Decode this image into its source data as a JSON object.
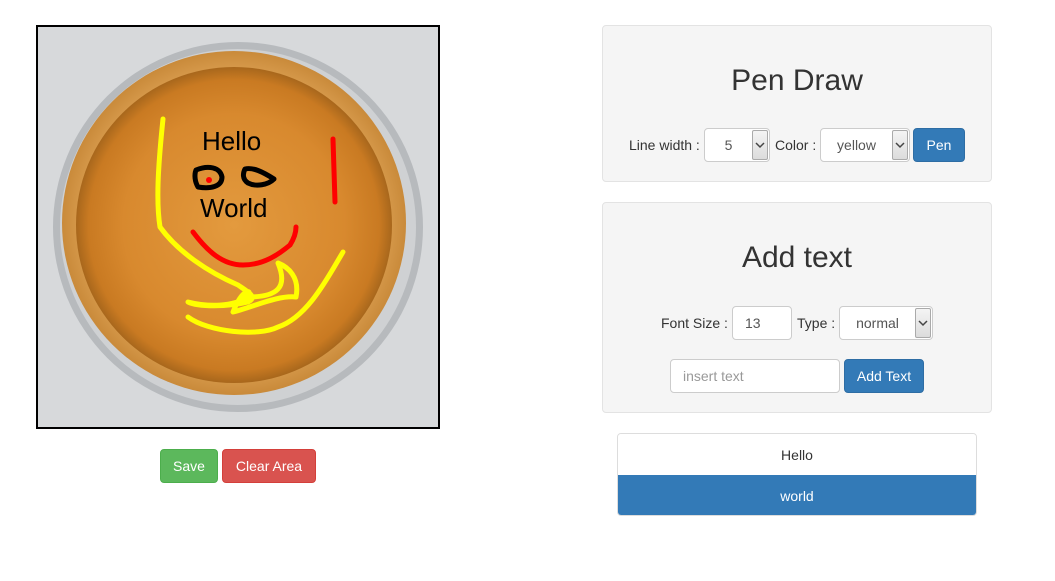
{
  "canvas": {
    "drawn_text": [
      "Hello",
      "World"
    ]
  },
  "actions": {
    "save_label": "Save",
    "clear_label": "Clear Area"
  },
  "pen_panel": {
    "title": "Pen Draw",
    "line_width_label": "Line width :",
    "line_width_value": "5",
    "color_label": "Color :",
    "color_value": "yellow",
    "pen_button": "Pen"
  },
  "text_panel": {
    "title": "Add text",
    "font_size_label": "Font Size :",
    "font_size_value": "13",
    "type_label": "Type :",
    "type_value": "normal",
    "text_placeholder": "insert text",
    "add_button": "Add Text"
  },
  "text_list": {
    "items": [
      "Hello",
      "world"
    ],
    "active_index": 1
  },
  "colors": {
    "success": "#5cb85c",
    "danger": "#d9534f",
    "primary": "#337ab7"
  }
}
